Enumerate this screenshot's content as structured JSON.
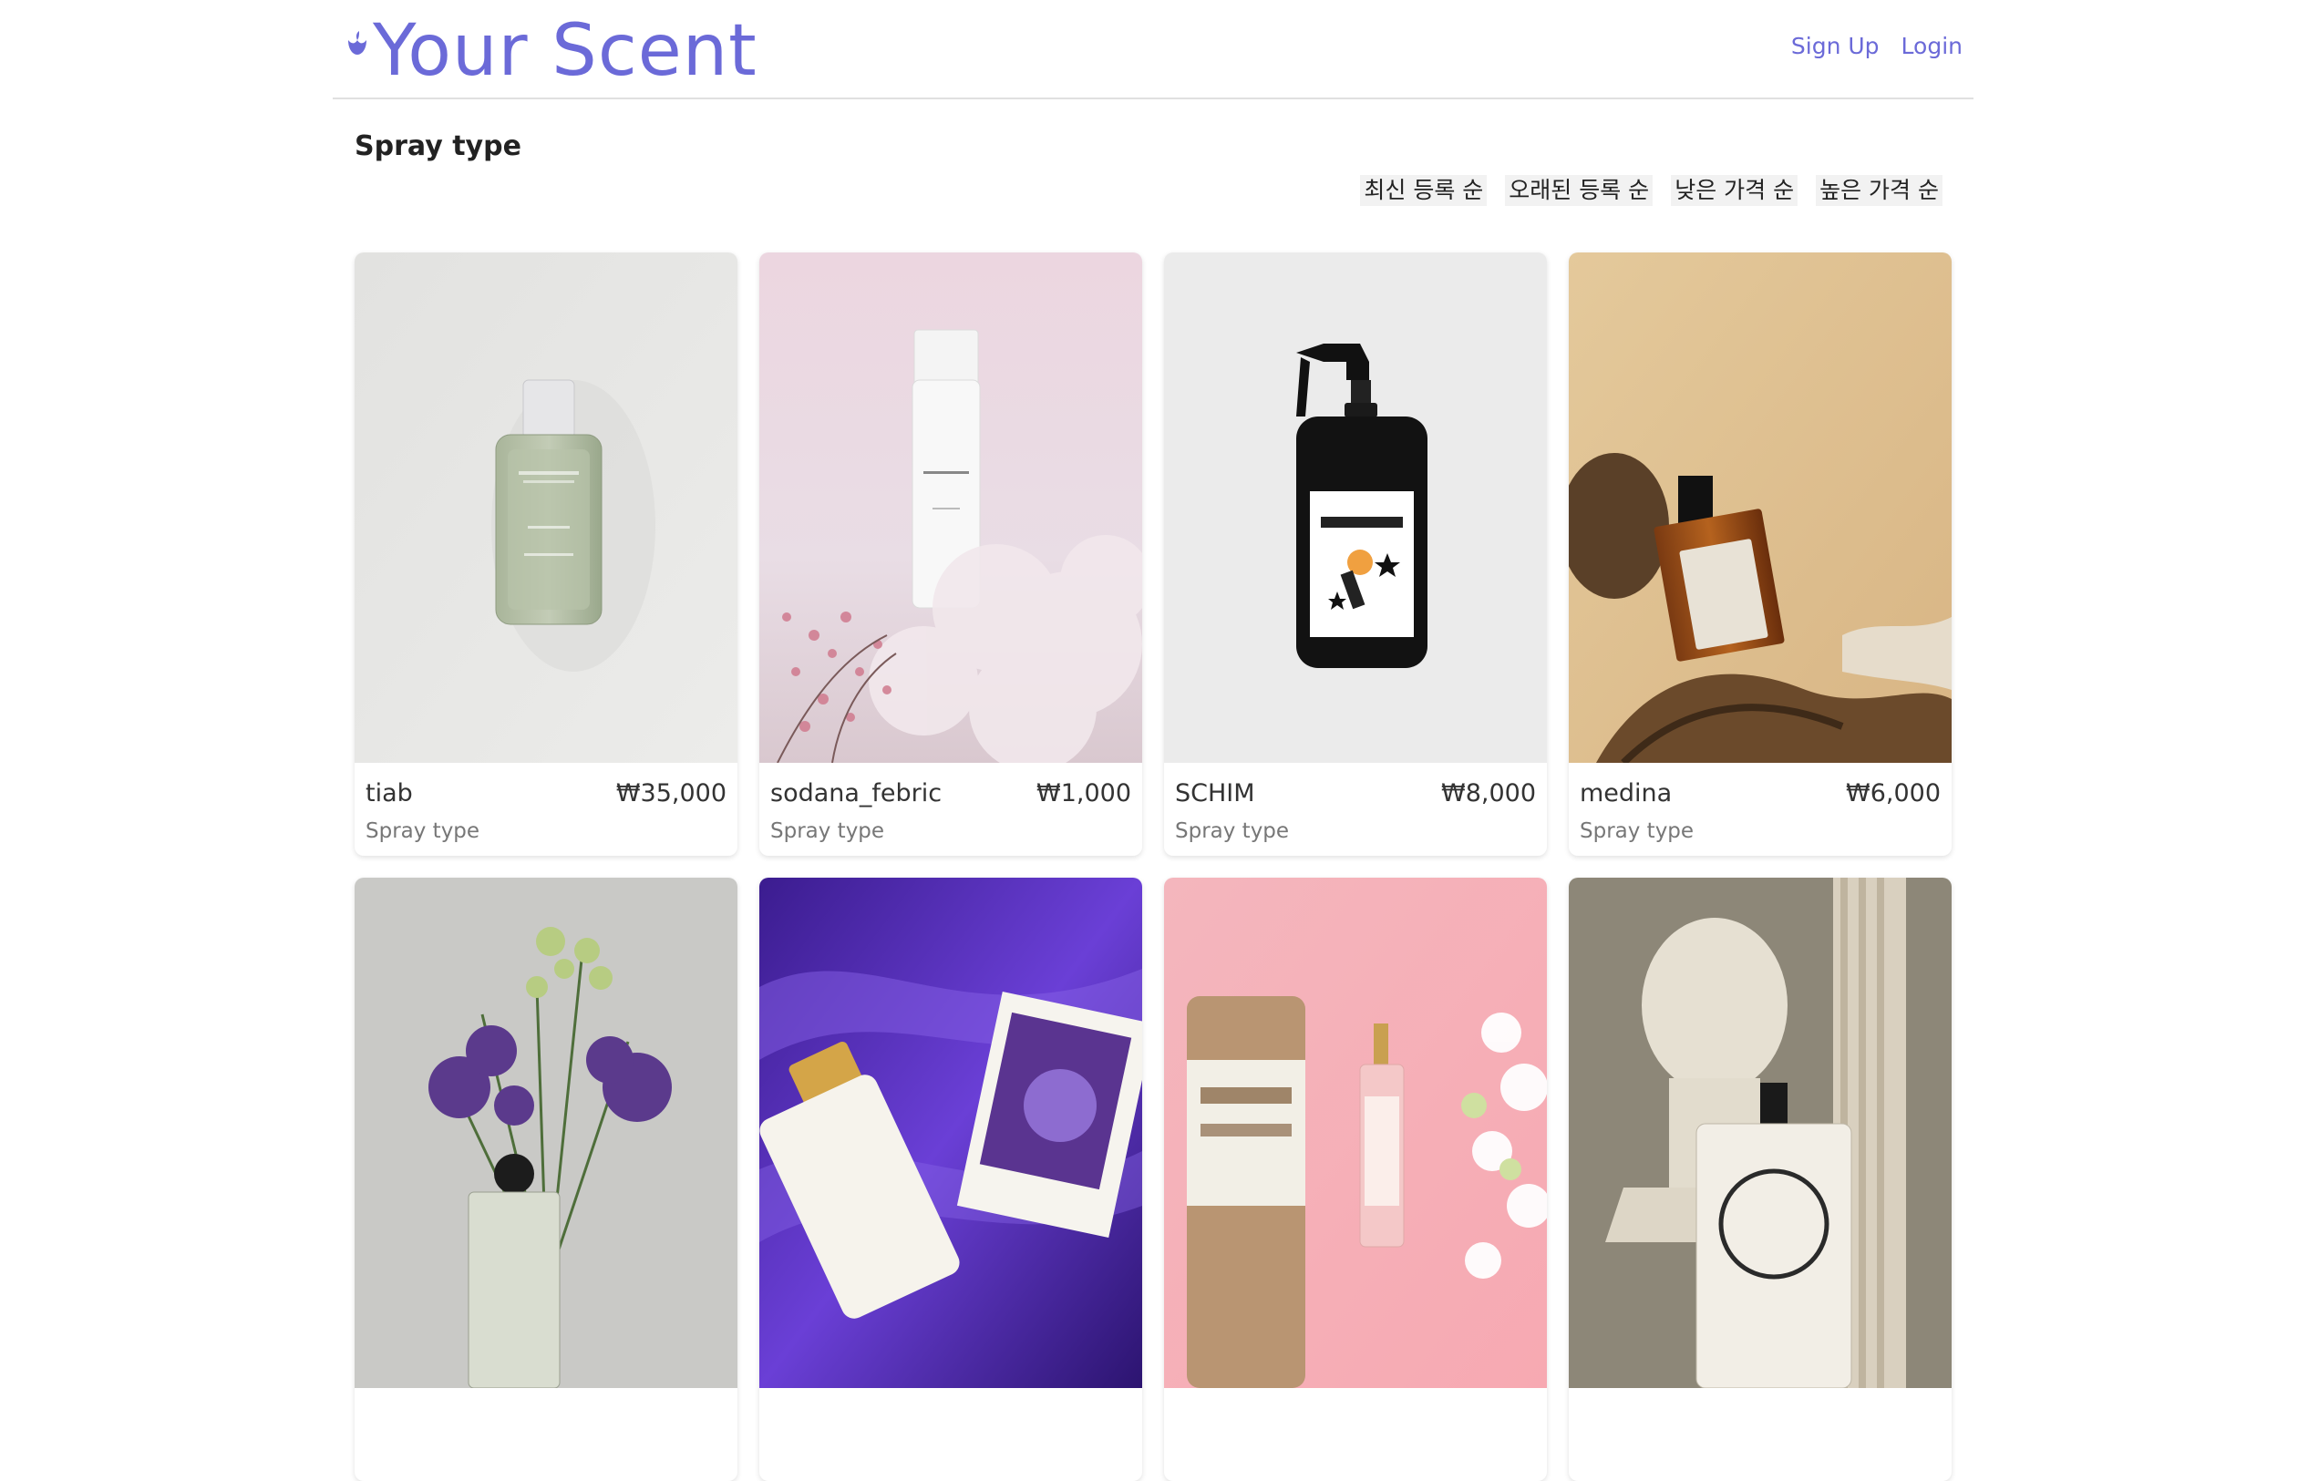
{
  "brand": {
    "logo_text": "Your Scent",
    "accent_color": "#6b6ad8"
  },
  "nav": {
    "signup_label": "Sign Up",
    "login_label": "Login"
  },
  "page": {
    "title": "Spray type"
  },
  "sort_options": [
    "최신 등록 순",
    "오래된 등록 순",
    "낮은 가격 순",
    "높은 가격 순"
  ],
  "products": [
    {
      "name": "tiab",
      "price": "₩35,000",
      "type": "Spray type",
      "image": "green-glass-bottle"
    },
    {
      "name": "sodana_febric",
      "price": "₩1,000",
      "type": "Spray type",
      "image": "white-bottle-pink-flowers"
    },
    {
      "name": "SCHIM",
      "price": "₩8,000",
      "type": "Spray type",
      "image": "black-spray-bottle"
    },
    {
      "name": "medina",
      "price": "₩6,000",
      "type": "Spray type",
      "image": "amber-bottle-driftwood"
    },
    {
      "name": "",
      "price": "",
      "type": "",
      "image": "purple-flowers-bottle"
    },
    {
      "name": "",
      "price": "",
      "type": "",
      "image": "white-bottle-purple-satin"
    },
    {
      "name": "",
      "price": "",
      "type": "",
      "image": "pink-bottle-tube"
    },
    {
      "name": "",
      "price": "",
      "type": "",
      "image": "pantheon-bottle-bust"
    }
  ]
}
